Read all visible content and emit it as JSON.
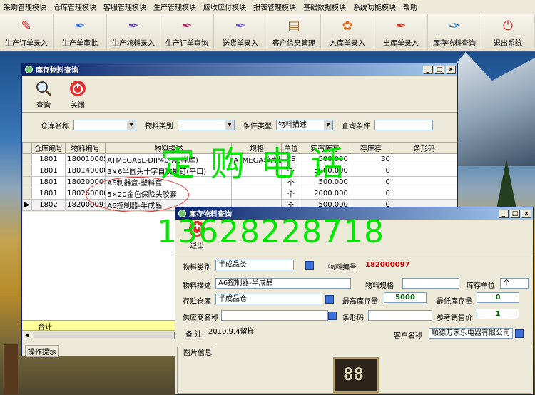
{
  "menu": [
    "采购管理模块",
    "仓库管理模块",
    "客服管理模块",
    "生产管理模块",
    "应收应付模块",
    "报表管理模块",
    "基础数据模块",
    "系统功能模块",
    "帮助"
  ],
  "toolbar": [
    {
      "label": "生产订单录入",
      "icon": "pdf-icon",
      "color": "#d02020"
    },
    {
      "label": "生产单审批",
      "icon": "pen-icon",
      "color": "#3a6fd8"
    },
    {
      "label": "生产领料录入",
      "icon": "pen-icon",
      "color": "#6040a0"
    },
    {
      "label": "生产订单查询",
      "icon": "pen-icon",
      "color": "#a03060"
    },
    {
      "label": "送货单录入",
      "icon": "pen-icon",
      "color": "#7060c0"
    },
    {
      "label": "客户信息管理",
      "icon": "book-icon",
      "color": "#a07030"
    },
    {
      "label": "入库单录入",
      "icon": "flower-icon",
      "color": "#e07020"
    },
    {
      "label": "出库单录入",
      "icon": "pen-icon",
      "color": "#c03020"
    },
    {
      "label": "库存物料查询",
      "icon": "feather-icon",
      "color": "#2080c0"
    },
    {
      "label": "退出系统",
      "icon": "power-icon",
      "color": "#e03030"
    }
  ],
  "win1": {
    "title": "库存物料查询",
    "btn_query": "查询",
    "btn_close": "关闭",
    "filter": {
      "warehouse_label": "仓库名称",
      "category_label": "物料类别",
      "condtype_label": "条件类型",
      "condtype_value": "物料描述",
      "cond_label": "查询条件"
    },
    "columns": [
      "仓库编号",
      "物料编号",
      "物料描述",
      "规格",
      "单位",
      "实有库存",
      "存库存",
      "条形码"
    ],
    "rows": [
      {
        "wh": "1801",
        "code": "1800100051",
        "desc": "ATMEGA6L-DIP40(A6样库)",
        "spec": "ATMEGA单片机",
        "unit": "CS",
        "stock": "500.000",
        "min": "30",
        "barcode": ""
      },
      {
        "wh": "1801",
        "code": "1801400002",
        "desc": "3×6半圆头十字自攻螺钉(平口)",
        "spec": "",
        "unit": "个",
        "stock": "5000.000",
        "min": "0",
        "barcode": ""
      },
      {
        "wh": "1801",
        "code": "1802000019",
        "desc": "A6制器盒-塑料盒",
        "spec": "",
        "unit": "个",
        "stock": "500.000",
        "min": "0",
        "barcode": ""
      },
      {
        "wh": "1801",
        "code": "1802600004",
        "desc": "5×20金色保险头胶套",
        "spec": "",
        "unit": "个",
        "stock": "2000.000",
        "min": "0",
        "barcode": ""
      },
      {
        "wh": "1802",
        "code": "182000097",
        "desc": "A6控制器-半成品",
        "spec": "",
        "unit": "个",
        "stock": "500.000",
        "min": "0",
        "barcode": ""
      }
    ],
    "sum_label": "合计",
    "status_label": "操作提示"
  },
  "win2": {
    "title": "库存物料查询",
    "btn_exit": "退出",
    "labels": {
      "category": "物料类别",
      "code": "物料编号",
      "desc": "物料描述",
      "spec": "物料规格",
      "unit": "库存单位",
      "warehouse": "存贮仓库",
      "max": "最高库存量",
      "min": "最低库存量",
      "supplier": "供应商名称",
      "barcode": "条形码",
      "price": "参考销售价",
      "remark": "备  注",
      "customer": "客户名称",
      "image": "图片信息"
    },
    "values": {
      "category": "半成品类",
      "code": "182000097",
      "desc": "A6控制器-半成品",
      "spec": "",
      "unit": "个",
      "warehouse": "半成品仓",
      "max": "5000",
      "min": "0",
      "supplier": "",
      "barcode": "",
      "price": "1",
      "remark": "2010.9.4留样",
      "customer": "顺德万家乐电器有限公司"
    },
    "display_digits": "88"
  },
  "watermark": {
    "line1": "定购电话",
    "line2": "13628228718"
  }
}
